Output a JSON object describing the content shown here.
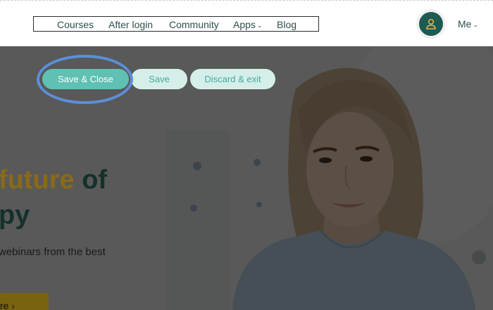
{
  "header": {
    "nav": [
      {
        "label": "Courses"
      },
      {
        "label": "After login"
      },
      {
        "label": "Community"
      },
      {
        "label": "Apps",
        "chevron": "⌄"
      },
      {
        "label": "Blog"
      }
    ],
    "avatar_icon": "user-icon",
    "me_label": "Me",
    "me_chevron": "⌄"
  },
  "toolbar": {
    "save_close_label": "Save & Close",
    "save_label": "Save",
    "discard_label": "Discard & exit"
  },
  "hero": {
    "headline_accent": "future",
    "headline_rest": " of",
    "headline_line2": "py",
    "subtext": "webinars from the best",
    "cta_label": "re",
    "cta_arrow": "›"
  },
  "colors": {
    "primary": "#5fc0b3",
    "primary_light": "#d5eeea",
    "brand_dark": "#1d5a52",
    "accent_gold": "#8a6a17",
    "annotation": "#5b8fd8"
  }
}
